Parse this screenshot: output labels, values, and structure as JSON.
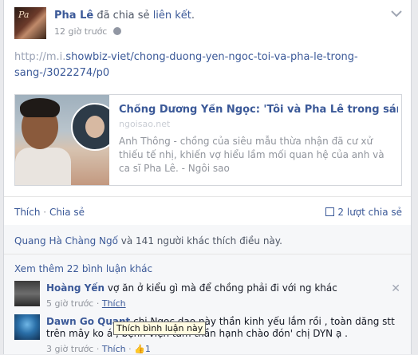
{
  "post": {
    "author": "Pha Lê",
    "action": "đã chia sẻ",
    "object": "liên kết",
    "time": "12 giờ trước",
    "avatar_logo": "Pa",
    "url_line1_blur": "http://m.i.",
    "url_line1_rest": "showbiz-viet/chong-duong-yen-ngoc-toi-va-pha-le-trong-",
    "url_line2": "sang-/3022274/p0"
  },
  "link_card": {
    "title": "Chồng Dương Yến Ngọc: 'Tôi và Pha Lê trong sáng' - Ngôi sao",
    "host": "ngoisao.net",
    "description": "Anh Thông - chồng của siêu mẫu thừa nhận đã cư xử thiếu tế nhị, khiến vợ hiểu lầm mối quan hệ của anh và ca sĩ Pha Lê. - Ngôi sao"
  },
  "actions": {
    "like": "Thích",
    "dot": " · ",
    "share": "Chia sẻ",
    "shares_count": "2 lượt chia sẻ"
  },
  "feedback": {
    "likes_name": "Quang Hà Chàng Ngố",
    "likes_rest": "và 141 người khác thích điều này.",
    "more_comments": "Xem thêm 22 bình luận khác"
  },
  "comments": [
    {
      "name": "Hoàng Yến",
      "text": "vợ ăn ở kiểu gì mà để chồng phải đi với ng khác",
      "time": "5 giờ trước",
      "like": "Thích"
    },
    {
      "name": "Dawn Go Quant",
      "text": "chị Ngọc dạo này thần kinh yếu lắm rồi , toàn dăng stt trên mây ko á , bệnh viện tâm thần hạnh chào đón' chị DYN ạ .",
      "time": "3 giờ trước",
      "like": "Thích",
      "like_count": "1"
    }
  ],
  "tooltip": "Thích bình luận này"
}
